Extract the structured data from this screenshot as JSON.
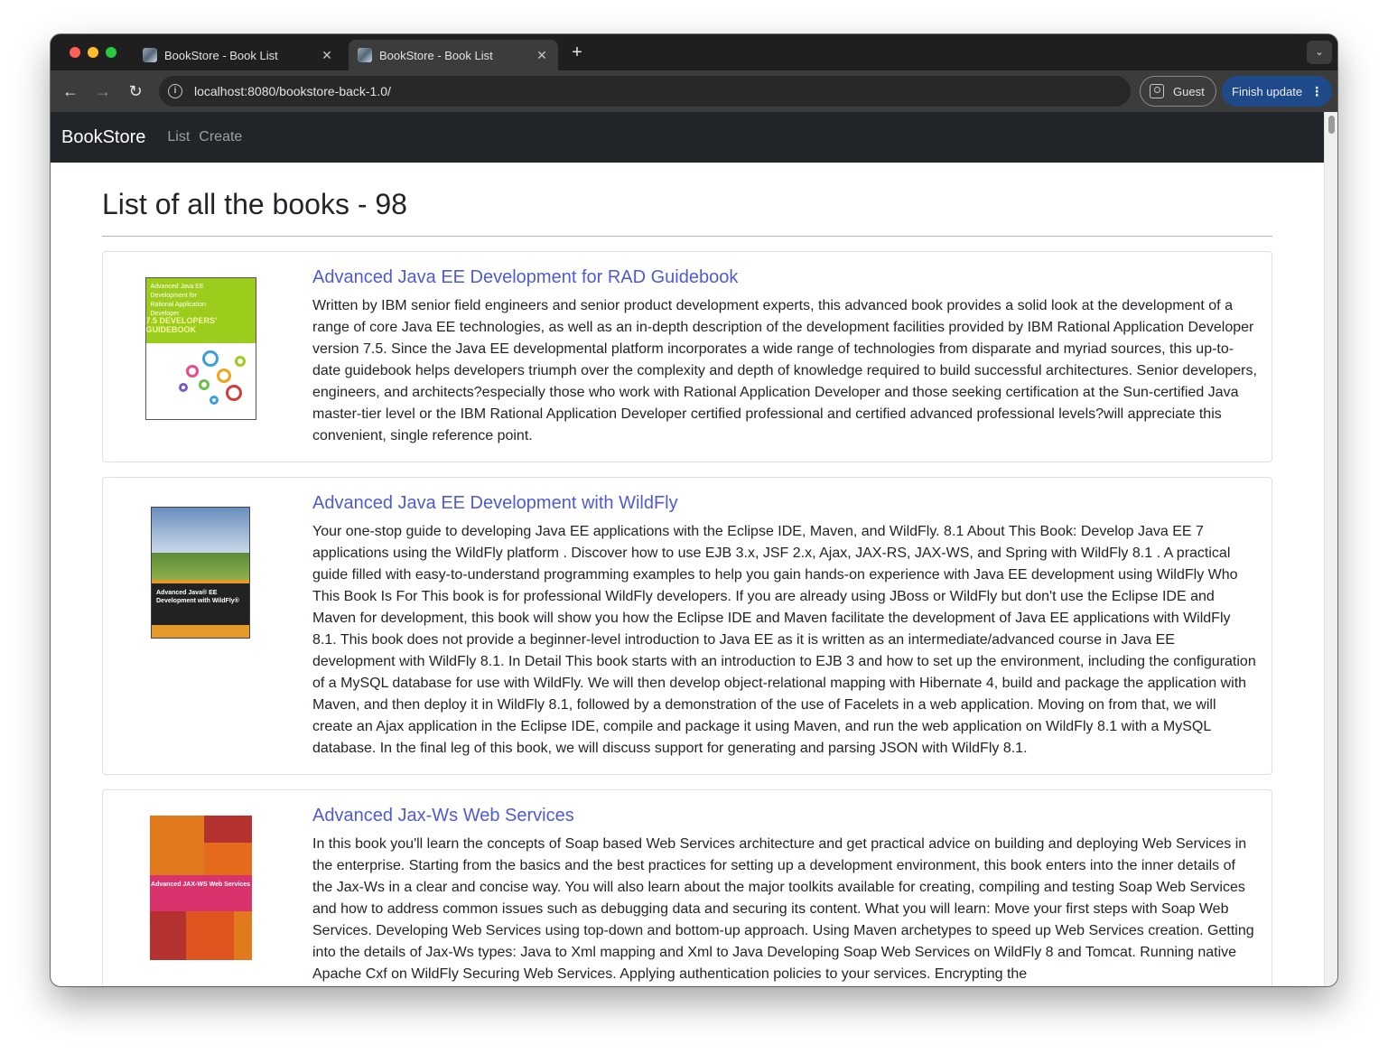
{
  "browser": {
    "tabs": [
      {
        "title": "BookStore - Book List",
        "active": false
      },
      {
        "title": "BookStore - Book List",
        "active": true
      }
    ],
    "url": "localhost:8080/bookstore-back-1.0/",
    "guest_label": "Guest",
    "finish_update_label": "Finish update"
  },
  "navbar": {
    "brand": "BookStore",
    "links": [
      "List",
      "Create"
    ]
  },
  "page": {
    "heading": "List of all the books - 98"
  },
  "books": [
    {
      "title": "Advanced Java EE Development for RAD Guidebook",
      "cover_text": "Advanced Java EE Development for Rational Application Developer",
      "cover_version": "7.5 DEVELOPERS' GUIDEBOOK",
      "description": "Written by IBM senior field engineers and senior product development experts, this advanced book provides a solid look at the development of a range of core Java EE technologies, as well as an in-depth description of the development facilities provided by IBM Rational Application Developer version 7.5. Since the Java EE developmental platform incorporates a wide range of technologies from disparate and myriad sources, this up-to-date guidebook helps developers triumph over the complexity and depth of knowledge required to build successful architectures. Senior developers, engineers, and architects?especially those who work with Rational Application Developer and those seeking certification at the Sun-certified Java master-tier level or the IBM Rational Application Developer certified professional and certified advanced professional levels?will appreciate this convenient, single reference point."
    },
    {
      "title": "Advanced Java EE Development with WildFly",
      "cover_text": "Advanced Java® EE Development with WildFly®",
      "description": "Your one-stop guide to developing Java EE applications with the Eclipse IDE, Maven, and WildFly. 8.1 About This Book: Develop Java EE 7 applications using the WildFly platform . Discover how to use EJB 3.x, JSF 2.x, Ajax, JAX-RS, JAX-WS, and Spring with WildFly 8.1 . A practical guide filled with easy-to-understand programming examples to help you gain hands-on experience with Java EE development using WildFly Who This Book Is For This book is for professional WildFly developers. If you are already using JBoss or WildFly but don't use the Eclipse IDE and Maven for development, this book will show you how the Eclipse IDE and Maven facilitate the development of Java EE applications with WildFly 8.1. This book does not provide a beginner-level introduction to Java EE as it is written as an intermediate/advanced course in Java EE development with WildFly 8.1. In Detail This book starts with an introduction to EJB 3 and how to set up the environment, including the configuration of a MySQL database for use with WildFly. We will then develop object-relational mapping with Hibernate 4, build and package the application with Maven, and then deploy it in WildFly 8.1, followed by a demonstration of the use of Facelets in a web application. Moving on from that, we will create an Ajax application in the Eclipse IDE, compile and package it using Maven, and run the web application on WildFly 8.1 with a MySQL database. In the final leg of this book, we will discuss support for generating and parsing JSON with WildFly 8.1."
    },
    {
      "title": "Advanced Jax-Ws Web Services",
      "cover_text": "Advanced JAX-WS Web Services",
      "description": "In this book you'll learn the concepts of Soap based Web Services architecture and get practical advice on building and deploying Web Services in the enterprise. Starting from the basics and the best practices for setting up a development environment, this book enters into the inner details of the Jax-Ws in a clear and concise way. You will also learn about the major toolkits available for creating, compiling and testing Soap Web Services and how to address common issues such as debugging data and securing its content. What you will learn: Move your first steps with Soap Web Services. Developing Web Services using top-down and bottom-up approach. Using Maven archetypes to speed up Web Services creation. Getting into the details of Jax-Ws types: Java to Xml mapping and Xml to Java Developing Soap Web Services on WildFly 8 and Tomcat. Running native Apache Cxf on WildFly Securing Web Services. Applying authentication policies to your services. Encrypting the"
    }
  ]
}
